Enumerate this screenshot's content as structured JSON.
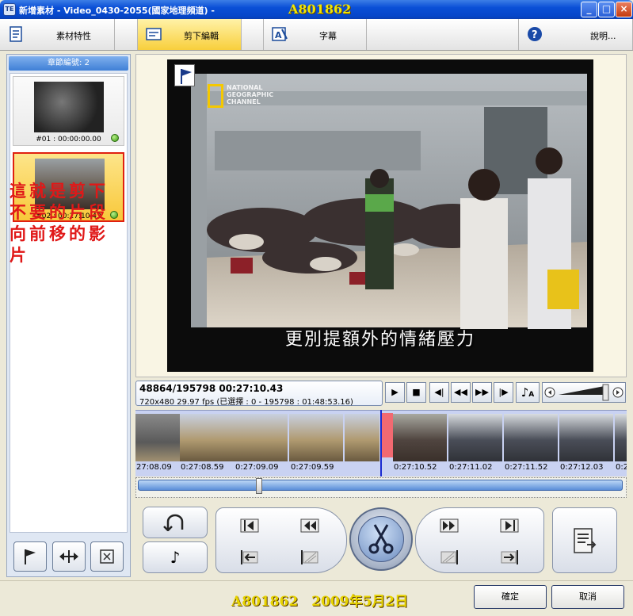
{
  "window": {
    "title": "新增素材 - Video_0430-2055(國家地理頻道) -",
    "watermark": "A801862",
    "minimize": "_",
    "maximize": "□",
    "close": "×"
  },
  "tabs": [
    {
      "label": "素材特性",
      "icon": "document-icon"
    },
    {
      "label": "剪下編輯",
      "icon": "cut-edit-icon",
      "active": true
    },
    {
      "label": "字幕",
      "icon": "subtitle-icon"
    },
    {
      "label": "說明...",
      "icon": "help-icon"
    }
  ],
  "chapters": {
    "header": "章節編號: 2",
    "items": [
      {
        "label": "#01 : 00:00:00.00"
      },
      {
        "label": "#02 : 00:27:10.43",
        "selected": true
      }
    ]
  },
  "annotation": "這就是剪下不要的片段向前移的影片",
  "video": {
    "subtitle": "更別提額外的情緒壓力",
    "logo_text": "NATIONAL GEOGRAPHIC CHANNEL"
  },
  "info": {
    "frame_time": "48864/195798  00:27:10.43",
    "spec": "720x480 29.97 fps (已選擇 : 0 - 195798 : 01:48:53.16)"
  },
  "transport": [
    "play",
    "stop",
    "prev-frame",
    "rewind",
    "fast-forward",
    "next-frame",
    "audio"
  ],
  "timeline": {
    "labels": [
      "27:08.09",
      "0:27:08.59",
      "0:27:09.09",
      "0:27:09.59",
      "",
      "0:27:10.52",
      "0:27:11.02",
      "0:27:11.52",
      "0:27:12.03",
      "0:2"
    ]
  },
  "footer": {
    "watermark": "A801862　2009年5月2日",
    "ok": "確定",
    "cancel": "取消"
  },
  "colors": {
    "accent": "#f8cf3c",
    "annotation": "#e01818",
    "titlebar": "#0a4fd6"
  }
}
